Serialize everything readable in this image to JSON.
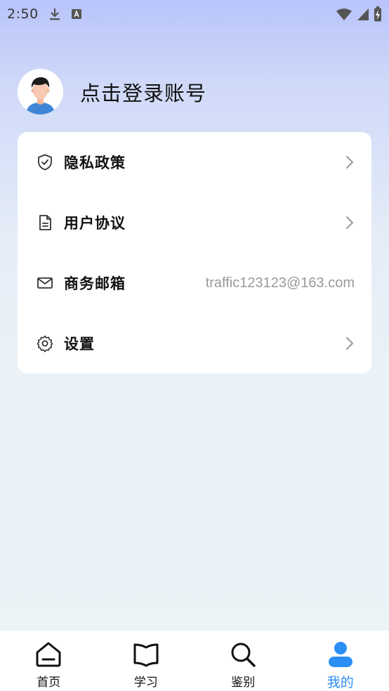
{
  "status_bar": {
    "time": "2:50",
    "icons": [
      "download-icon",
      "keyboard-a-icon",
      "wifi-icon",
      "signal-icon",
      "battery-charging-icon"
    ]
  },
  "profile": {
    "login_text": "点击登录账号",
    "avatar": "avatar-icon"
  },
  "menu": {
    "items": [
      {
        "label": "隐私政策",
        "icon": "shield-check-icon",
        "value": "",
        "has_chevron": true
      },
      {
        "label": "用户协议",
        "icon": "document-icon",
        "value": "",
        "has_chevron": true
      },
      {
        "label": "商务邮箱",
        "icon": "mail-icon",
        "value": "traffic123123@163.com",
        "has_chevron": false
      },
      {
        "label": "设置",
        "icon": "gear-icon",
        "value": "",
        "has_chevron": true
      }
    ]
  },
  "bottom_nav": {
    "items": [
      {
        "label": "首页",
        "icon": "home-icon",
        "active": false
      },
      {
        "label": "学习",
        "icon": "book-icon",
        "active": false
      },
      {
        "label": "鉴别",
        "icon": "search-icon",
        "active": false
      },
      {
        "label": "我的",
        "icon": "user-icon",
        "active": true
      }
    ],
    "active_color": "#2b8ef5"
  }
}
